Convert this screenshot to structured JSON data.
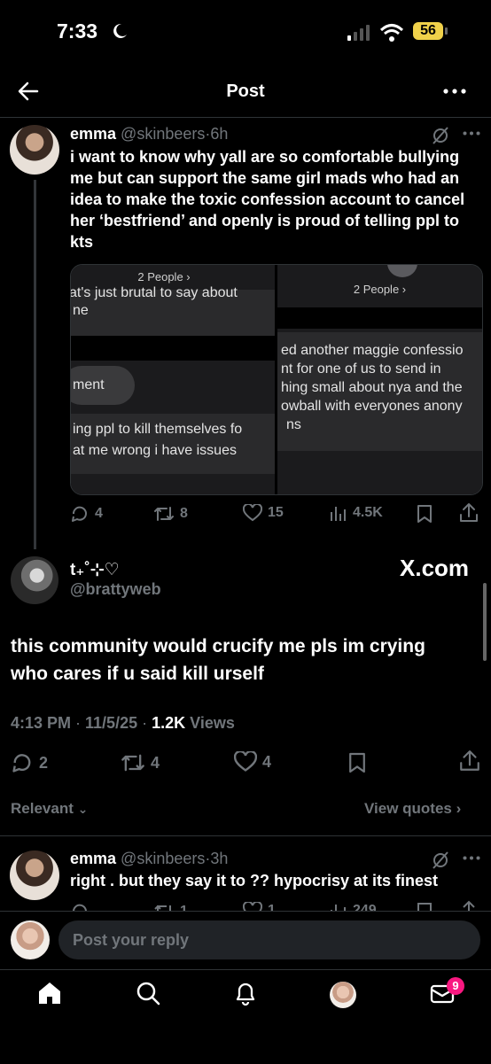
{
  "status_bar": {
    "time": "7:33",
    "battery": "56"
  },
  "header": {
    "title": "Post"
  },
  "parent_tweet": {
    "name": "emma",
    "handle": "@skinbeers",
    "age": "6h",
    "text": "i want to know why yall are so comfortable bullying me but can support the same girl mads who had an idea to make the toxic  confession account to cancel her ‘bestfriend’  and openly is proud of telling ppl to kts",
    "screenshot_left": {
      "header": "2 People",
      "line1": "at's just brutal to say about",
      "line2": "ne",
      "bubble": "ment",
      "line3": "ing ppl to kill themselves fo",
      "line4": "at me wrong i have issues"
    },
    "screenshot_right": {
      "header": "2 People",
      "line1": "ed another maggie confessio",
      "line2": "nt for one of us to send in",
      "line3": "hing small about nya and the",
      "line4": "owball with everyones anony",
      "line5": "ns"
    },
    "replies": "4",
    "reposts": "8",
    "likes": "15",
    "views": "4.5K"
  },
  "main_tweet": {
    "name": "t₊˚⊹♡",
    "handle": "@brattyweb",
    "brand": "X.com",
    "text_line1": "this community would crucify me pls im crying",
    "text_line2": "who cares if u said kill urself",
    "time": "4:13 PM",
    "date": "11/5/25",
    "views_count": "1.2K",
    "views_label": "Views",
    "replies": "2",
    "reposts": "4",
    "likes": "4"
  },
  "sort": {
    "label": "Relevant",
    "view_quotes": "View quotes"
  },
  "reply_tweet": {
    "name": "emma",
    "handle": "@skinbeers",
    "age": "3h",
    "text": "right . but they say it to ?? hypocrisy at its finest",
    "replies": "",
    "reposts": "1",
    "likes": "1",
    "views": "249"
  },
  "composer": {
    "placeholder": "Post your reply"
  },
  "tabbar": {
    "messages_badge": "9"
  }
}
